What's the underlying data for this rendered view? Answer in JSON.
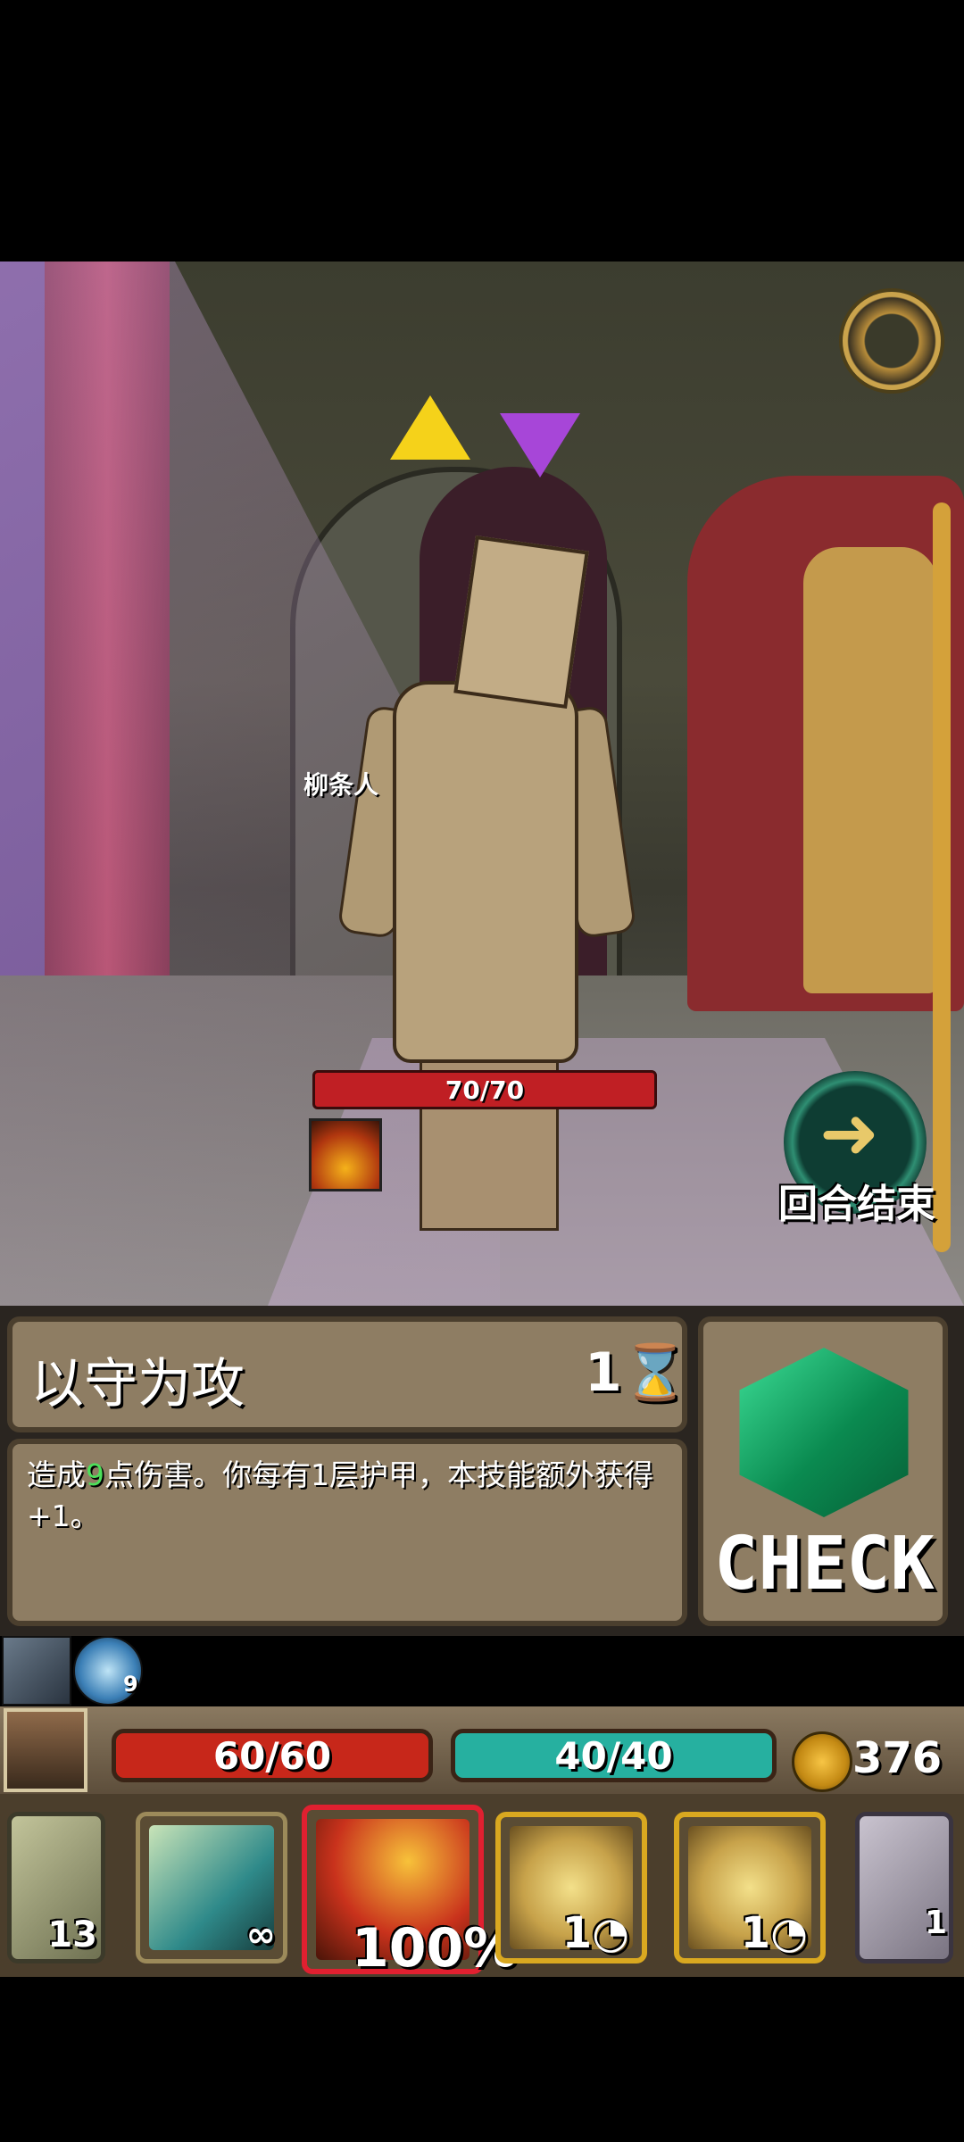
{
  "enemy": {
    "name": "柳条人",
    "hp": "70/70"
  },
  "end_turn": {
    "label": "回合结束"
  },
  "selected_card": {
    "title": "以守为攻",
    "cost": "1⌛",
    "desc_prefix": "造成",
    "desc_value": "9",
    "desc_suffix": "点伤害。你每有1层护甲，本技能额外获得+1。"
  },
  "check_button": {
    "label": "CHECK"
  },
  "buffs": {
    "shield_count": "9"
  },
  "player": {
    "hp": "60/60",
    "mp": "40/40",
    "gold": "376"
  },
  "hand": {
    "draw_pile_count": "13",
    "card1_label": "∞",
    "card2_label": "100%",
    "card3_label": "1◔",
    "card4_label": "1◔",
    "discard_count": "1"
  },
  "colors": {
    "enemy_hp": "#c01f24",
    "player_hp": "#c7271a",
    "player_mp": "#26b0a0",
    "highlight": "#4ce05a",
    "panel": "#8e7d63"
  }
}
